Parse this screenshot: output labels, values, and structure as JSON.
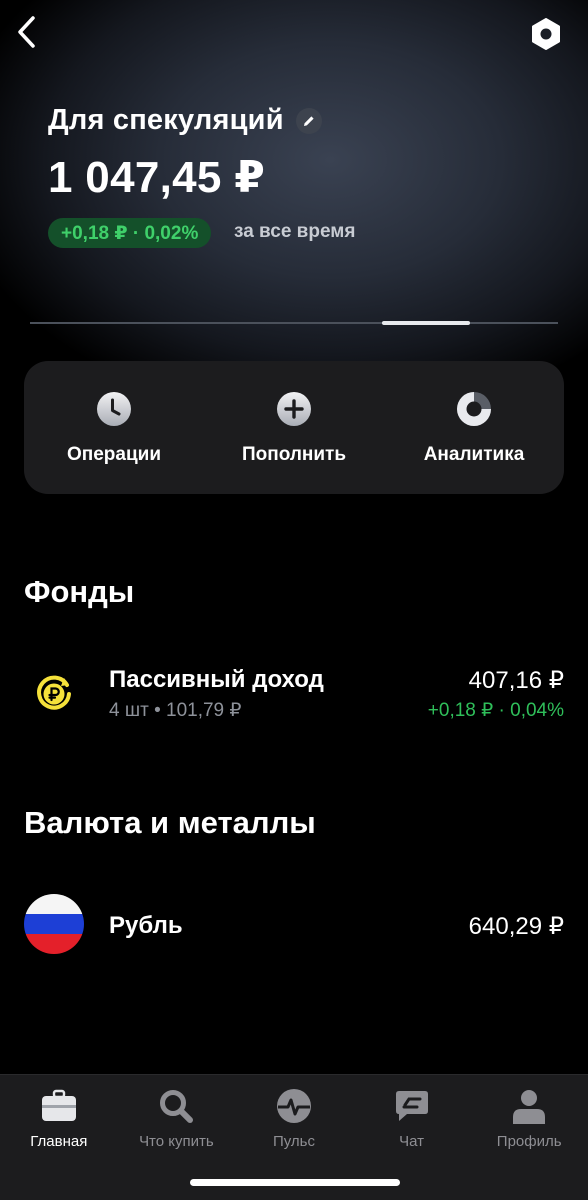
{
  "nav": {
    "back_icon": "chevron-left-icon",
    "settings_icon": "hexagon-settings-icon"
  },
  "account": {
    "title": "Для спекуляций",
    "edit_icon": "pencil-icon",
    "balance": "1 047,45 ₽",
    "change": "+0,18 ₽ · 0,02%",
    "change_period": "за все время",
    "change_color": "#3fd06a"
  },
  "pager": {
    "pages": 3,
    "active_index": 2
  },
  "actions": [
    {
      "label": "Операции",
      "icon": "clock-icon"
    },
    {
      "label": "Пополнить",
      "icon": "plus-circle-icon"
    },
    {
      "label": "Аналитика",
      "icon": "pie-chart-icon"
    }
  ],
  "funds": {
    "title": "Фонды",
    "items": [
      {
        "name": "Пассивный доход",
        "sub": "4 шт • 101,79 ₽",
        "value": "407,16 ₽",
        "change": "+0,18 ₽ · 0,04%",
        "icon": "ruble-coin-icon"
      }
    ]
  },
  "currency": {
    "title": "Валюта и металлы",
    "items": [
      {
        "name": "Рубль",
        "value": "640,29 ₽",
        "icon": "russia-flag-icon"
      }
    ]
  },
  "tabs": [
    {
      "label": "Главная",
      "icon": "briefcase-icon",
      "active": true
    },
    {
      "label": "Что купить",
      "icon": "search-icon",
      "active": false
    },
    {
      "label": "Пульс",
      "icon": "pulse-icon",
      "active": false
    },
    {
      "label": "Чат",
      "icon": "chat-icon",
      "active": false
    },
    {
      "label": "Профиль",
      "icon": "profile-icon",
      "active": false
    }
  ],
  "colors": {
    "accent_green": "#2fbf5a",
    "card": "#1c1c1e",
    "background": "#000000"
  }
}
